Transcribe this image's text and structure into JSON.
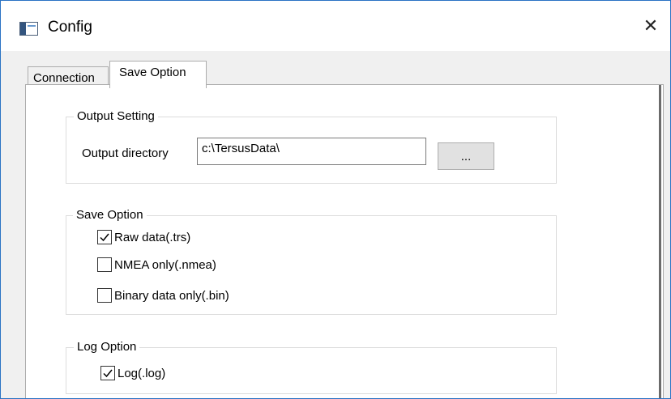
{
  "window": {
    "title": "Config",
    "close_glyph": "✕"
  },
  "tabs": [
    {
      "label": "Connection",
      "selected": false
    },
    {
      "label": "Save Option",
      "selected": true
    }
  ],
  "output_setting": {
    "group_label": "Output Setting",
    "directory_label": "Output directory",
    "directory_value": "c:\\TersusData\\",
    "browse_label": "..."
  },
  "save_option": {
    "group_label": "Save Option",
    "items": [
      {
        "label": "Raw data(.trs)",
        "checked": true
      },
      {
        "label": "NMEA only(.nmea)",
        "checked": false
      },
      {
        "label": "Binary data only(.bin)",
        "checked": false
      }
    ]
  },
  "log_option": {
    "group_label": "Log Option",
    "items": [
      {
        "label": "Log(.log)",
        "checked": true
      }
    ]
  },
  "icons": {
    "app": "window-app-icon",
    "close": "close-icon",
    "check": "checkmark-icon"
  },
  "colors": {
    "window_border": "#2a73c4",
    "dialog_background": "#f0f0f0",
    "panel_background": "#ffffff",
    "group_border": "#dcdcdc",
    "button_face": "#e1e1e1"
  }
}
